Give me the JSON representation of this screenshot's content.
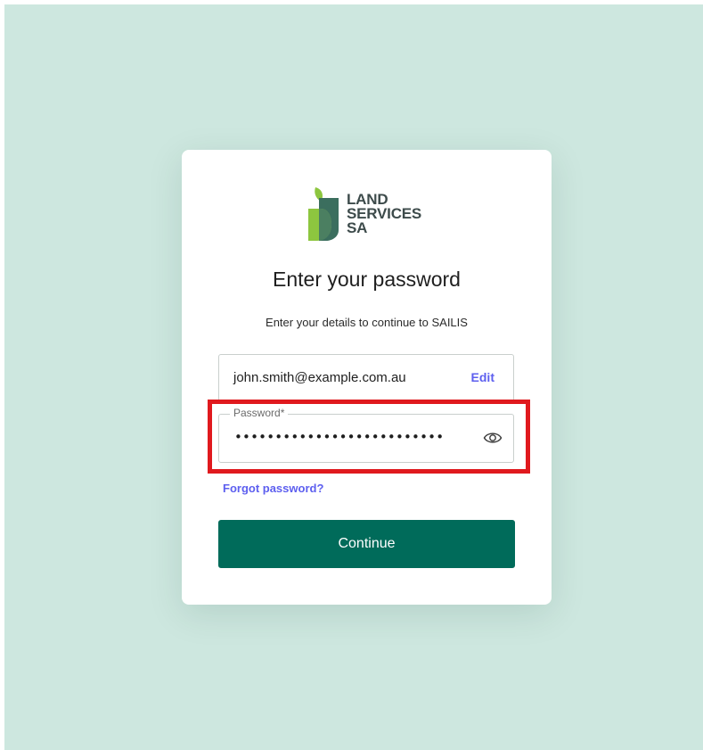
{
  "brand": {
    "logo_line1": "LAND",
    "logo_line2": "SERVICES",
    "logo_line3": "SA",
    "colors": {
      "logo_light_green": "#8dc63f",
      "logo_dark_green": "#3b6e5e",
      "logo_text": "#3d4b4b"
    }
  },
  "form": {
    "title": "Enter your password",
    "subtitle": "Enter your details to continue to SAILIS",
    "email_value": "john.smith@example.com.au",
    "edit_label": "Edit",
    "password_label": "Password*",
    "password_value": "••••••••••••••••••••••••••",
    "password_toggle_icon": "eye-icon",
    "forgot_label": "Forgot password?",
    "continue_label": "Continue"
  },
  "colors": {
    "background": "#cde7df",
    "primary_button": "#006b5a",
    "link": "#5d5fef",
    "highlight": "#e0191e"
  }
}
